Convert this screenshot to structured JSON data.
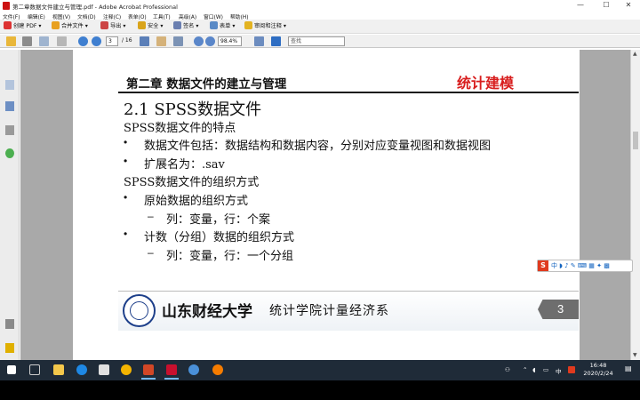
{
  "window": {
    "title": "第二章数据文件建立与管理.pdf - Adobe Acrobat Professional",
    "controls": [
      "—",
      "☐",
      "✕"
    ]
  },
  "menu": [
    "文件(F)",
    "编辑(E)",
    "视图(V)",
    "文档(D)",
    "注释(C)",
    "表单(O)",
    "工具(T)",
    "高级(A)",
    "窗口(W)",
    "帮助(H)"
  ],
  "toolbar1": {
    "create_pdf": "创建 PDF",
    "combine": "合并文件",
    "export": "导出",
    "secure": "安全",
    "sign": "签名",
    "forms": "表单",
    "review": "审阅和注释"
  },
  "toolbar2": {
    "page_current": "3",
    "page_total": "/ 16",
    "zoom": "98.4%",
    "search_placeholder": "查找"
  },
  "slide": {
    "chapter_title": "第二章  数据文件的建立与管理",
    "brand": "统计建模",
    "section": "2.1    SPSS数据文件",
    "items": [
      {
        "level": 0,
        "bullet": "",
        "text": "SPSS数据文件的特点"
      },
      {
        "level": 1,
        "bullet": "•",
        "text": "数据文件包括：数据结构和数据内容，分别对应变量视图和数据视图"
      },
      {
        "level": 1,
        "bullet": "•",
        "text": "扩展名为：.sav"
      },
      {
        "level": 0,
        "bullet": "",
        "text": "SPSS数据文件的组织方式"
      },
      {
        "level": 1,
        "bullet": "•",
        "text": "原始数据的组织方式"
      },
      {
        "level": 2,
        "bullet": "–",
        "text": "列：变量，行：个案"
      },
      {
        "level": 1,
        "bullet": "•",
        "text": "计数（分组）数据的组织方式"
      },
      {
        "level": 2,
        "bullet": "–",
        "text": "列：变量，行：一个分组"
      }
    ],
    "school": "山东财经大学",
    "department": "统计学院计量经济系",
    "page_number": "3"
  },
  "ime": {
    "logo": "S",
    "lang": "中"
  },
  "taskbar": {
    "time": "16:48",
    "date": "2020/2/24",
    "input_lang": "中"
  },
  "colors": {
    "brand_red": "#d81e1e",
    "taskbar": "#1f2b38",
    "doc_bg": "#a9a9a9"
  }
}
